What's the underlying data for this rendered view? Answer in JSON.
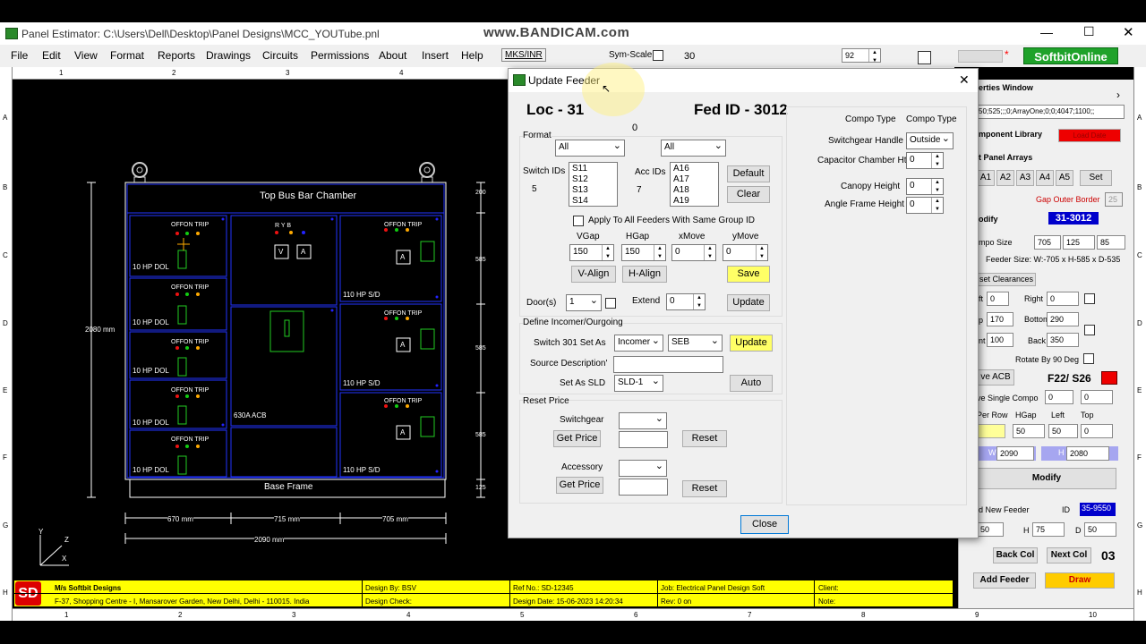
{
  "watermark": "www.BANDICAM.com",
  "window": {
    "title": "Panel Estimator: C:\\Users\\Dell\\Desktop\\Panel Designs\\MCC_YOUTube.pnl"
  },
  "menu": [
    "File",
    "Edit",
    "View",
    "Format",
    "Reports",
    "Drawings",
    "Circuits",
    "Permissions",
    "About",
    "Insert",
    "Help",
    "MKS/INR"
  ],
  "toolbar": {
    "sym_scale_label": "Sym-Scale",
    "sym_scale_value": "30",
    "zoom_value": "92",
    "asterisk": "*",
    "brand": "SoftbitOnline"
  },
  "ruler": {
    "top": [
      "1",
      "2",
      "3",
      "4",
      "5",
      "6",
      "7",
      "8",
      "9",
      "10"
    ],
    "bottom": [
      "1",
      "2",
      "3",
      "4",
      "5",
      "6",
      "7",
      "8",
      "9",
      "10"
    ],
    "side": [
      "A",
      "B",
      "C",
      "D",
      "E",
      "F",
      "G",
      "H"
    ]
  },
  "drawing": {
    "top_bus": "Top Bus Bar Chamber",
    "base": "Base Frame",
    "trip_label": "OFFON TRIP",
    "feeders_left": [
      "10 HP DOL",
      "10 HP DOL",
      "10 HP DOL",
      "10 HP DOL",
      "10 HP DOL"
    ],
    "feeders_right": [
      "110 HP S/D",
      "110 HP S/D",
      "110 HP S/D"
    ],
    "incomer": "630A ACB",
    "ryb": "R Y B",
    "meter_v": "V",
    "meter_a": "A",
    "height_dim": "2080 mm",
    "right_dims": [
      "200",
      "585",
      "585",
      "585",
      "125"
    ],
    "width_dims": [
      "670 mm",
      "715 mm",
      "705 mm"
    ],
    "total_width": "2090 mm",
    "axes": {
      "y": "Y",
      "z": "Z",
      "x": "X"
    }
  },
  "dialog": {
    "title": "Update Feeder",
    "loc": "Loc - 31",
    "fed_id": "Fed ID - 3012",
    "zero": "0",
    "format_label": "Format",
    "format1": "All",
    "format2": "All",
    "switch_ids_label": "Switch IDs",
    "switch_count": "5",
    "switch_ids": [
      "S11",
      "S12",
      "S13",
      "S14"
    ],
    "acc_ids_label": "Acc IDs",
    "acc_count": "7",
    "acc_ids": [
      "A16",
      "A17",
      "A18",
      "A19"
    ],
    "default_btn": "Default",
    "clear_btn": "Clear",
    "apply_all": "Apply To All Feeders With Same Group ID",
    "vgap_label": "VGap",
    "hgap_label": "HGap",
    "xmove_label": "xMove",
    "ymove_label": "yMove",
    "vgap": "150",
    "hgap": "150",
    "xmove": "0",
    "ymove": "0",
    "valign": "V-Align",
    "halign": "H-Align",
    "save": "Save",
    "doors_label": "Door(s)",
    "doors": "1",
    "extend_label": "Extend",
    "extend": "0",
    "update": "Update",
    "incomer_section": "Define Incomer/Ourgoing",
    "switch_set_label": "Switch 301 Set As",
    "switch_set": "Incomer",
    "switch_set2": "SEB",
    "update2": "Update",
    "source_label": "Source Description'",
    "sld_label": "Set As SLD",
    "sld": "SLD-1",
    "auto": "Auto",
    "reset_price": "Reset Price",
    "switchgear_label": "Switchgear",
    "get_price": "Get Price",
    "reset": "Reset",
    "accessory_label": "Accessory",
    "compo_type_label": "Compo Type",
    "compo_type_head": "Compo Type",
    "sw_handle_label": "Switchgear Handle",
    "sw_handle": "Outside",
    "cap_label": "Capacitor Chamber Ht",
    "cap": "0",
    "canopy_label": "Canopy Height",
    "canopy": "0",
    "angle_label": "Angle Frame Height",
    "angle": "0",
    "close": "Close"
  },
  "props": {
    "title": "erties Window",
    "value_row": "50;525;;;0;ArrayOne;0;0;4047;1100;;",
    "comp_lib": "mponent Library",
    "load_date": "Load Date",
    "panel_arrays": "t Panel Arrays",
    "arrays": [
      "A1",
      "A2",
      "A3",
      "A4",
      "A5"
    ],
    "set": "Set",
    "gap_outer": "Gap Outer Border",
    "gap_val": "25",
    "modify_head": "odify",
    "id_badge": "31-3012",
    "compo_size": "mpo Size",
    "size_vals": [
      "705",
      "125",
      "85"
    ],
    "feeder_size": "Feeder Size: W:-705 x H-585 x D-535",
    "clearances": "set Clearances",
    "left_label": "ft",
    "left": "0",
    "right_label": "Right",
    "right": "0",
    "top_label": "p",
    "top": "170",
    "bottom_label": "Bottom",
    "bottom": "290",
    "front_label": "nt",
    "front": "100",
    "back_label": "Back",
    "back": "350",
    "rotate": "Rotate By 90 Deg",
    "acb": "ve ACB",
    "f22": "F22/ S26",
    "single": "ve Single Compo",
    "single1": "0",
    "single2": "0",
    "per_row": "Per Row",
    "hgap": "HGap",
    "left2": "Left",
    "top2": "Top",
    "row_vals": [
      "50",
      "50",
      "0"
    ],
    "w_label": "W",
    "w": "2090",
    "h_label": "H",
    "h": "2080",
    "modify": "Modify",
    "new_feeder": "d New Feeder",
    "id_label": "ID",
    "id_val": "35-9550",
    "nf_vals": [
      "50",
      "75",
      "50"
    ],
    "h2": "H",
    "d2": "D",
    "back_col": "Back Col",
    "next_col": "Next Col",
    "num": "03",
    "add_feeder": "Add Feeder",
    "draw": "Draw"
  },
  "footer": {
    "company": "M/s Softbit Designs",
    "address": "F-37, Shopping Centre - I, Mansarover Garden, New Delhi, Delhi - 110015. India",
    "design_by": "Design By: BSV",
    "design_check": "Design Check:",
    "ref": "Ref No.: SD-12345",
    "date": "Design Date: 15-06-2023 14:20:34",
    "job": "Job: Electrical Panel Design Soft",
    "rev": "Rev: 0 on",
    "client": "Client:",
    "note": "Note:",
    "logo": "SD"
  }
}
